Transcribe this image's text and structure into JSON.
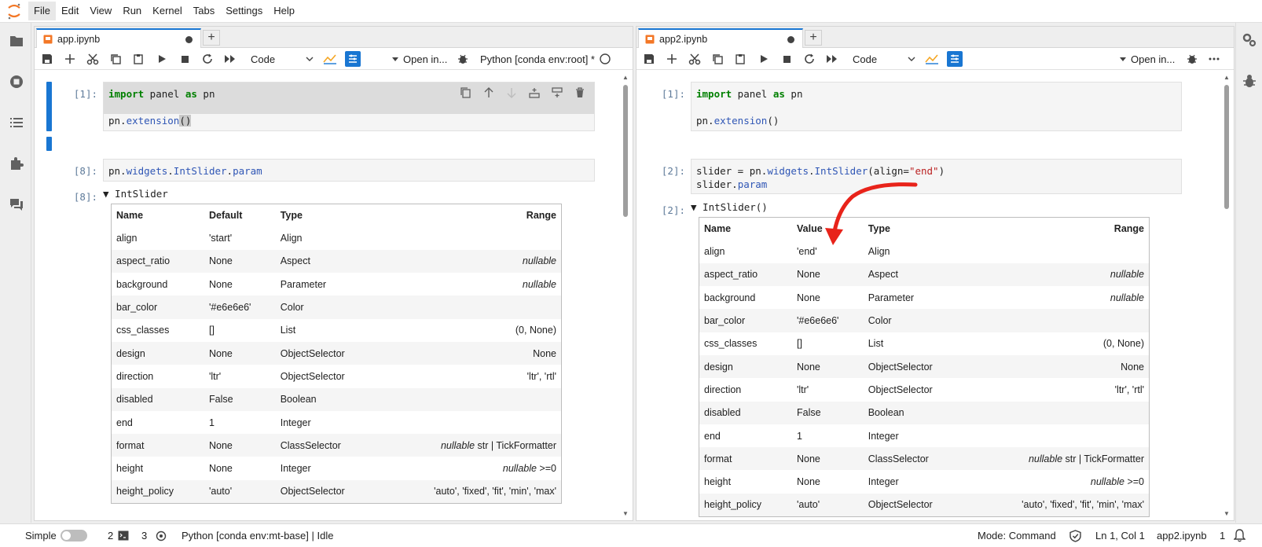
{
  "menubar": {
    "items": [
      "File",
      "Edit",
      "View",
      "Run",
      "Kernel",
      "Tabs",
      "Settings",
      "Help"
    ]
  },
  "left_sidebar": {
    "icons": [
      "folder-icon",
      "running-icon",
      "toc-icon",
      "extension-icon",
      "chat-icon"
    ]
  },
  "right_sidebar": {
    "icons": [
      "property-inspector-icon",
      "debugger-icon"
    ]
  },
  "left_panel": {
    "tab_label": "app.ipynb",
    "cell_type": "Code",
    "open_in": "Open in...",
    "kernel": "Python [conda env:root] *",
    "cell1": {
      "prompt": "[1]:",
      "code_kw": "import",
      "code_mid": " panel ",
      "code_kw2": "as",
      "code_tail": " pn",
      "code_line2_a": "pn.",
      "code_line2_b": "extension",
      "code_line2_c": "()"
    },
    "cell2": {
      "prompt": "[8]:",
      "code_a": "pn.",
      "code_b": "widgets",
      "code_c": ".",
      "code_d": "IntSlider",
      "code_e": ".",
      "code_f": "param"
    },
    "output": {
      "prompt": "[8]:",
      "title": "▼ IntSlider",
      "headers": [
        "Name",
        "Default",
        "Type",
        "Range"
      ],
      "rows": [
        {
          "name": "align",
          "value": "'start'",
          "type": "Align",
          "range_em": "",
          "range": ""
        },
        {
          "name": "aspect_ratio",
          "value": "None",
          "type": "Aspect",
          "range_em": "nullable",
          "range": ""
        },
        {
          "name": "background",
          "value": "None",
          "type": "Parameter",
          "range_em": "nullable",
          "range": ""
        },
        {
          "name": "bar_color",
          "value": "'#e6e6e6'",
          "type": "Color",
          "range_em": "",
          "range": ""
        },
        {
          "name": "css_classes",
          "value": "[]",
          "type": "List",
          "range_em": "",
          "range": "(0, None)"
        },
        {
          "name": "design",
          "value": "None",
          "type": "ObjectSelector",
          "range_em": "",
          "range": "None"
        },
        {
          "name": "direction",
          "value": "'ltr'",
          "type": "ObjectSelector",
          "range_em": "",
          "range": "'ltr', 'rtl'"
        },
        {
          "name": "disabled",
          "value": "False",
          "type": "Boolean",
          "range_em": "",
          "range": ""
        },
        {
          "name": "end",
          "value": "1",
          "type": "Integer",
          "range_em": "",
          "range": ""
        },
        {
          "name": "format",
          "value": "None",
          "type": "ClassSelector",
          "range_em": "nullable",
          "range": " str | TickFormatter"
        },
        {
          "name": "height",
          "value": "None",
          "type": "Integer",
          "range_em": "nullable",
          "range": " >=0"
        },
        {
          "name": "height_policy",
          "value": "'auto'",
          "type": "ObjectSelector",
          "range_em": "",
          "range": "'auto', 'fixed', 'fit', 'min', 'max'"
        }
      ]
    }
  },
  "right_panel": {
    "tab_label": "app2.ipynb",
    "cell_type": "Code",
    "open_in": "Open in...",
    "cell1": {
      "prompt": "[1]:",
      "code_kw": "import",
      "code_mid": " panel ",
      "code_kw2": "as",
      "code_tail": " pn",
      "code_line2_a": "pn.",
      "code_line2_b": "extension",
      "code_line2_c": "()"
    },
    "cell2": {
      "prompt": "[2]:",
      "line1_a": "slider = pn.",
      "line1_b": "widgets",
      "line1_c": ".",
      "line1_d": "IntSlider",
      "line1_e": "(align=",
      "line1_f": "\"end\"",
      "line1_g": ")",
      "line2_a": "slider.",
      "line2_b": "param"
    },
    "output": {
      "prompt": "[2]:",
      "title": "▼ IntSlider()",
      "headers": [
        "Name",
        "Value",
        "Type",
        "Range"
      ],
      "rows": [
        {
          "name": "align",
          "value": "'end'",
          "type": "Align",
          "range_em": "",
          "range": ""
        },
        {
          "name": "aspect_ratio",
          "value": "None",
          "type": "Aspect",
          "range_em": "nullable",
          "range": ""
        },
        {
          "name": "background",
          "value": "None",
          "type": "Parameter",
          "range_em": "nullable",
          "range": ""
        },
        {
          "name": "bar_color",
          "value": "'#e6e6e6'",
          "type": "Color",
          "range_em": "",
          "range": ""
        },
        {
          "name": "css_classes",
          "value": "[]",
          "type": "List",
          "range_em": "",
          "range": "(0, None)"
        },
        {
          "name": "design",
          "value": "None",
          "type": "ObjectSelector",
          "range_em": "",
          "range": "None"
        },
        {
          "name": "direction",
          "value": "'ltr'",
          "type": "ObjectSelector",
          "range_em": "",
          "range": "'ltr', 'rtl'"
        },
        {
          "name": "disabled",
          "value": "False",
          "type": "Boolean",
          "range_em": "",
          "range": ""
        },
        {
          "name": "end",
          "value": "1",
          "type": "Integer",
          "range_em": "",
          "range": ""
        },
        {
          "name": "format",
          "value": "None",
          "type": "ClassSelector",
          "range_em": "nullable",
          "range": " str | TickFormatter"
        },
        {
          "name": "height",
          "value": "None",
          "type": "Integer",
          "range_em": "nullable",
          "range": " >=0"
        },
        {
          "name": "height_policy",
          "value": "'auto'",
          "type": "ObjectSelector",
          "range_em": "",
          "range": "'auto', 'fixed', 'fit', 'min', 'max'"
        }
      ]
    }
  },
  "statusbar": {
    "mode_simple": "Simple",
    "terminals": "2",
    "kernels": "3",
    "kernel_status": "Python [conda env:mt-base] | Idle",
    "mode": "Mode: Command",
    "position": "Ln 1, Col 1",
    "file": "app2.ipynb",
    "notifications": "1"
  },
  "colors": {
    "accent": "#1976d2",
    "annotation_arrow": "#e8231a"
  }
}
